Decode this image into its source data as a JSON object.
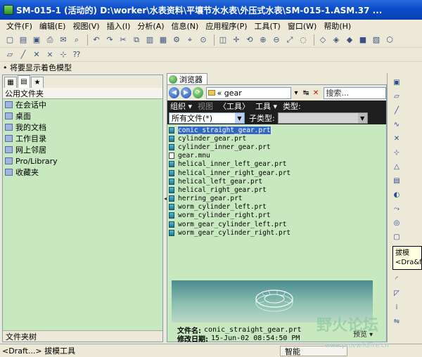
{
  "window": {
    "title": "SM-015-1 (活动的) D:\\worker\\水表资料\\平壤节水水表\\外压式水表\\SM-015-1.ASM.37 ..."
  },
  "menubar": [
    "文件(F)",
    "编辑(E)",
    "视图(V)",
    "插入(I)",
    "分析(A)",
    "信息(N)",
    "应用程序(P)",
    "工具(T)",
    "窗口(W)",
    "帮助(H)"
  ],
  "message": "• 将要显示着色模型",
  "left_pane": {
    "section_title": "公用文件夹",
    "folders": [
      "在会话中",
      "桌面",
      "我的文档",
      "工作目录",
      "网上邻居",
      "Pro/Library",
      "收藏夹"
    ],
    "footer": "文件夹树"
  },
  "browser": {
    "tab_label": "浏览器",
    "address": "« gear",
    "search_placeholder": "搜索...",
    "commands": {
      "organize": "组织 ▾",
      "view": "视图",
      "tools_bracket": "〈工具〉",
      "tools": "工具 ▾",
      "type": "类型:"
    },
    "filter": {
      "all_files": "所有文件(*)",
      "subtype_label": "子类型:"
    },
    "files": [
      {
        "name": "conic_straight_gear.prt",
        "selected": true,
        "kind": "part"
      },
      {
        "name": "cylinder_gear.prt",
        "selected": false,
        "kind": "part"
      },
      {
        "name": "cylinder_inner_gear.prt",
        "selected": false,
        "kind": "part"
      },
      {
        "name": "gear.mnu",
        "selected": false,
        "kind": "doc"
      },
      {
        "name": "helical_inner_left_gear.prt",
        "selected": false,
        "kind": "part"
      },
      {
        "name": "helical_inner_right_gear.prt",
        "selected": false,
        "kind": "part"
      },
      {
        "name": "helical_left_gear.prt",
        "selected": false,
        "kind": "part"
      },
      {
        "name": "helical_right_gear.prt",
        "selected": false,
        "kind": "part"
      },
      {
        "name": "herring_gear.prt",
        "selected": false,
        "kind": "part"
      },
      {
        "name": "worm_cylinder_left.prt",
        "selected": false,
        "kind": "part"
      },
      {
        "name": "worm_cylinder_right.prt",
        "selected": false,
        "kind": "part"
      },
      {
        "name": "worm_gear_cylinder_left.prt",
        "selected": false,
        "kind": "part"
      },
      {
        "name": "worm_gear_cylinder_right.prt",
        "selected": false,
        "kind": "part"
      }
    ],
    "preview_info": {
      "filename_label": "文件名:",
      "filename": "conic_straight_gear.prt",
      "date_label": "修改日期:",
      "date": "15-Jun-02 08:54:50 PM",
      "preview_button": "预览 ▾"
    }
  },
  "tooltip": {
    "line1": "拔模",
    "line2": "<Dra&f"
  },
  "statusbar": {
    "left": "<Draft...> 拔模工具",
    "mode": "智能"
  },
  "watermark": {
    "text": "野火论坛",
    "url": "www.proewildfire.cn"
  },
  "colors": {
    "title_bar": "#0a4cc9",
    "pane_bg": "#c8e8c0",
    "selection": "#316ac5",
    "command_bar": "#1e1e1e"
  }
}
